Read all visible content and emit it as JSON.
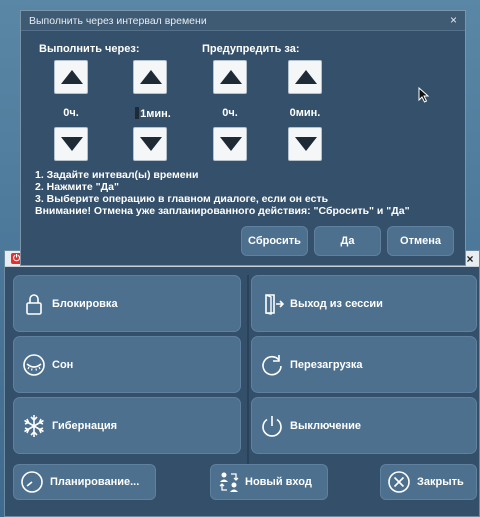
{
  "dialog": {
    "title": "Выполнить через интервал времени",
    "close_glyph": "×",
    "execute_after_label": "Выполнить через:",
    "warn_before_label": "Предупредить за:",
    "execute_hours": "0ч.",
    "execute_minutes": "1мин.",
    "warn_hours": "0ч.",
    "warn_minutes": "0мин.",
    "instructions": [
      "1. Задайте интевал(ы) времени",
      "2. Нажмите \"Да\"",
      "3. Выберите операцию в главном диалоге, если он есть",
      "Внимание! Отмена уже запланированного действия: \"Сбросить\" и \"Да\""
    ],
    "reset_label": "Сбросить",
    "yes_label": "Да",
    "cancel_label": "Отмена"
  },
  "power_window": {
    "app_icon": "power-app-icon",
    "close_glyph": "×",
    "lock_label": "Блокировка",
    "logoff_label": "Выход из сессии",
    "sleep_label": "Сон",
    "restart_label": "Перезагрузка",
    "hibernate_label": "Гибернация",
    "shutdown_label": "Выключение",
    "schedule_label": "Планирование...",
    "new_login_label": "Новый вход",
    "close_label": "Закрыть"
  },
  "colors": {
    "tile_bg": "#4d708f",
    "window_bg": "#334f69",
    "dialog_bg": "#35506a"
  }
}
